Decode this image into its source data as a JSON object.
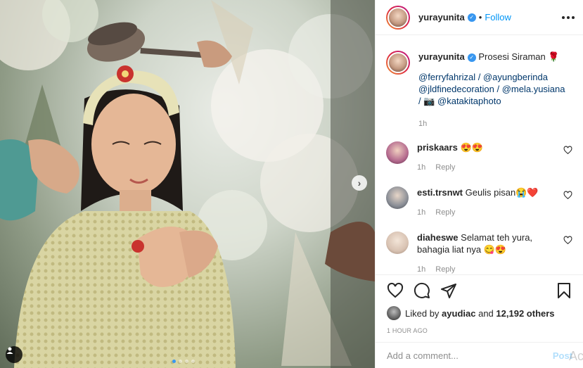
{
  "post": {
    "username": "yurayunita",
    "follow_label": "Follow",
    "separator": "•",
    "caption_text": "Prosesi Siraman 🌹",
    "mentions_line1": "@ferryfahrizal / @ayungberinda",
    "mentions_line2": "@jldfinedecoration / @mela.yusiana",
    "mentions_line3": "/ 📷 @katakitaphoto",
    "caption_time": "1h"
  },
  "comments": [
    {
      "username": "priskaars",
      "text": "😍😍",
      "time": "1h",
      "reply_label": "Reply"
    },
    {
      "username": "esti.trsnwt",
      "text": "Geulis pisan😭❤️",
      "time": "1h",
      "reply_label": "Reply"
    },
    {
      "username": "diaheswe",
      "text": "Selamat teh yura, bahagia liat nya 😋😍",
      "time": "1h",
      "reply_label": "Reply"
    }
  ],
  "likes": {
    "prefix": "Liked by",
    "user": "ayudiac",
    "middle": "and",
    "count": "12,192 others"
  },
  "timestamp": "1 HOUR AGO",
  "add_comment": {
    "placeholder": "Add a comment...",
    "post_label": "Post"
  },
  "carousel": {
    "slides": 4,
    "active": 1
  },
  "watermark": "Act",
  "colors": {
    "accent": "#0095f6",
    "verified": "#3897f0",
    "muted": "#8e8e8e",
    "text": "#262626"
  },
  "icons": [
    "more-options-icon",
    "verified-badge-icon",
    "heart-icon",
    "comment-icon",
    "share-icon",
    "bookmark-icon",
    "user-tag-icon",
    "chevron-right-icon"
  ]
}
